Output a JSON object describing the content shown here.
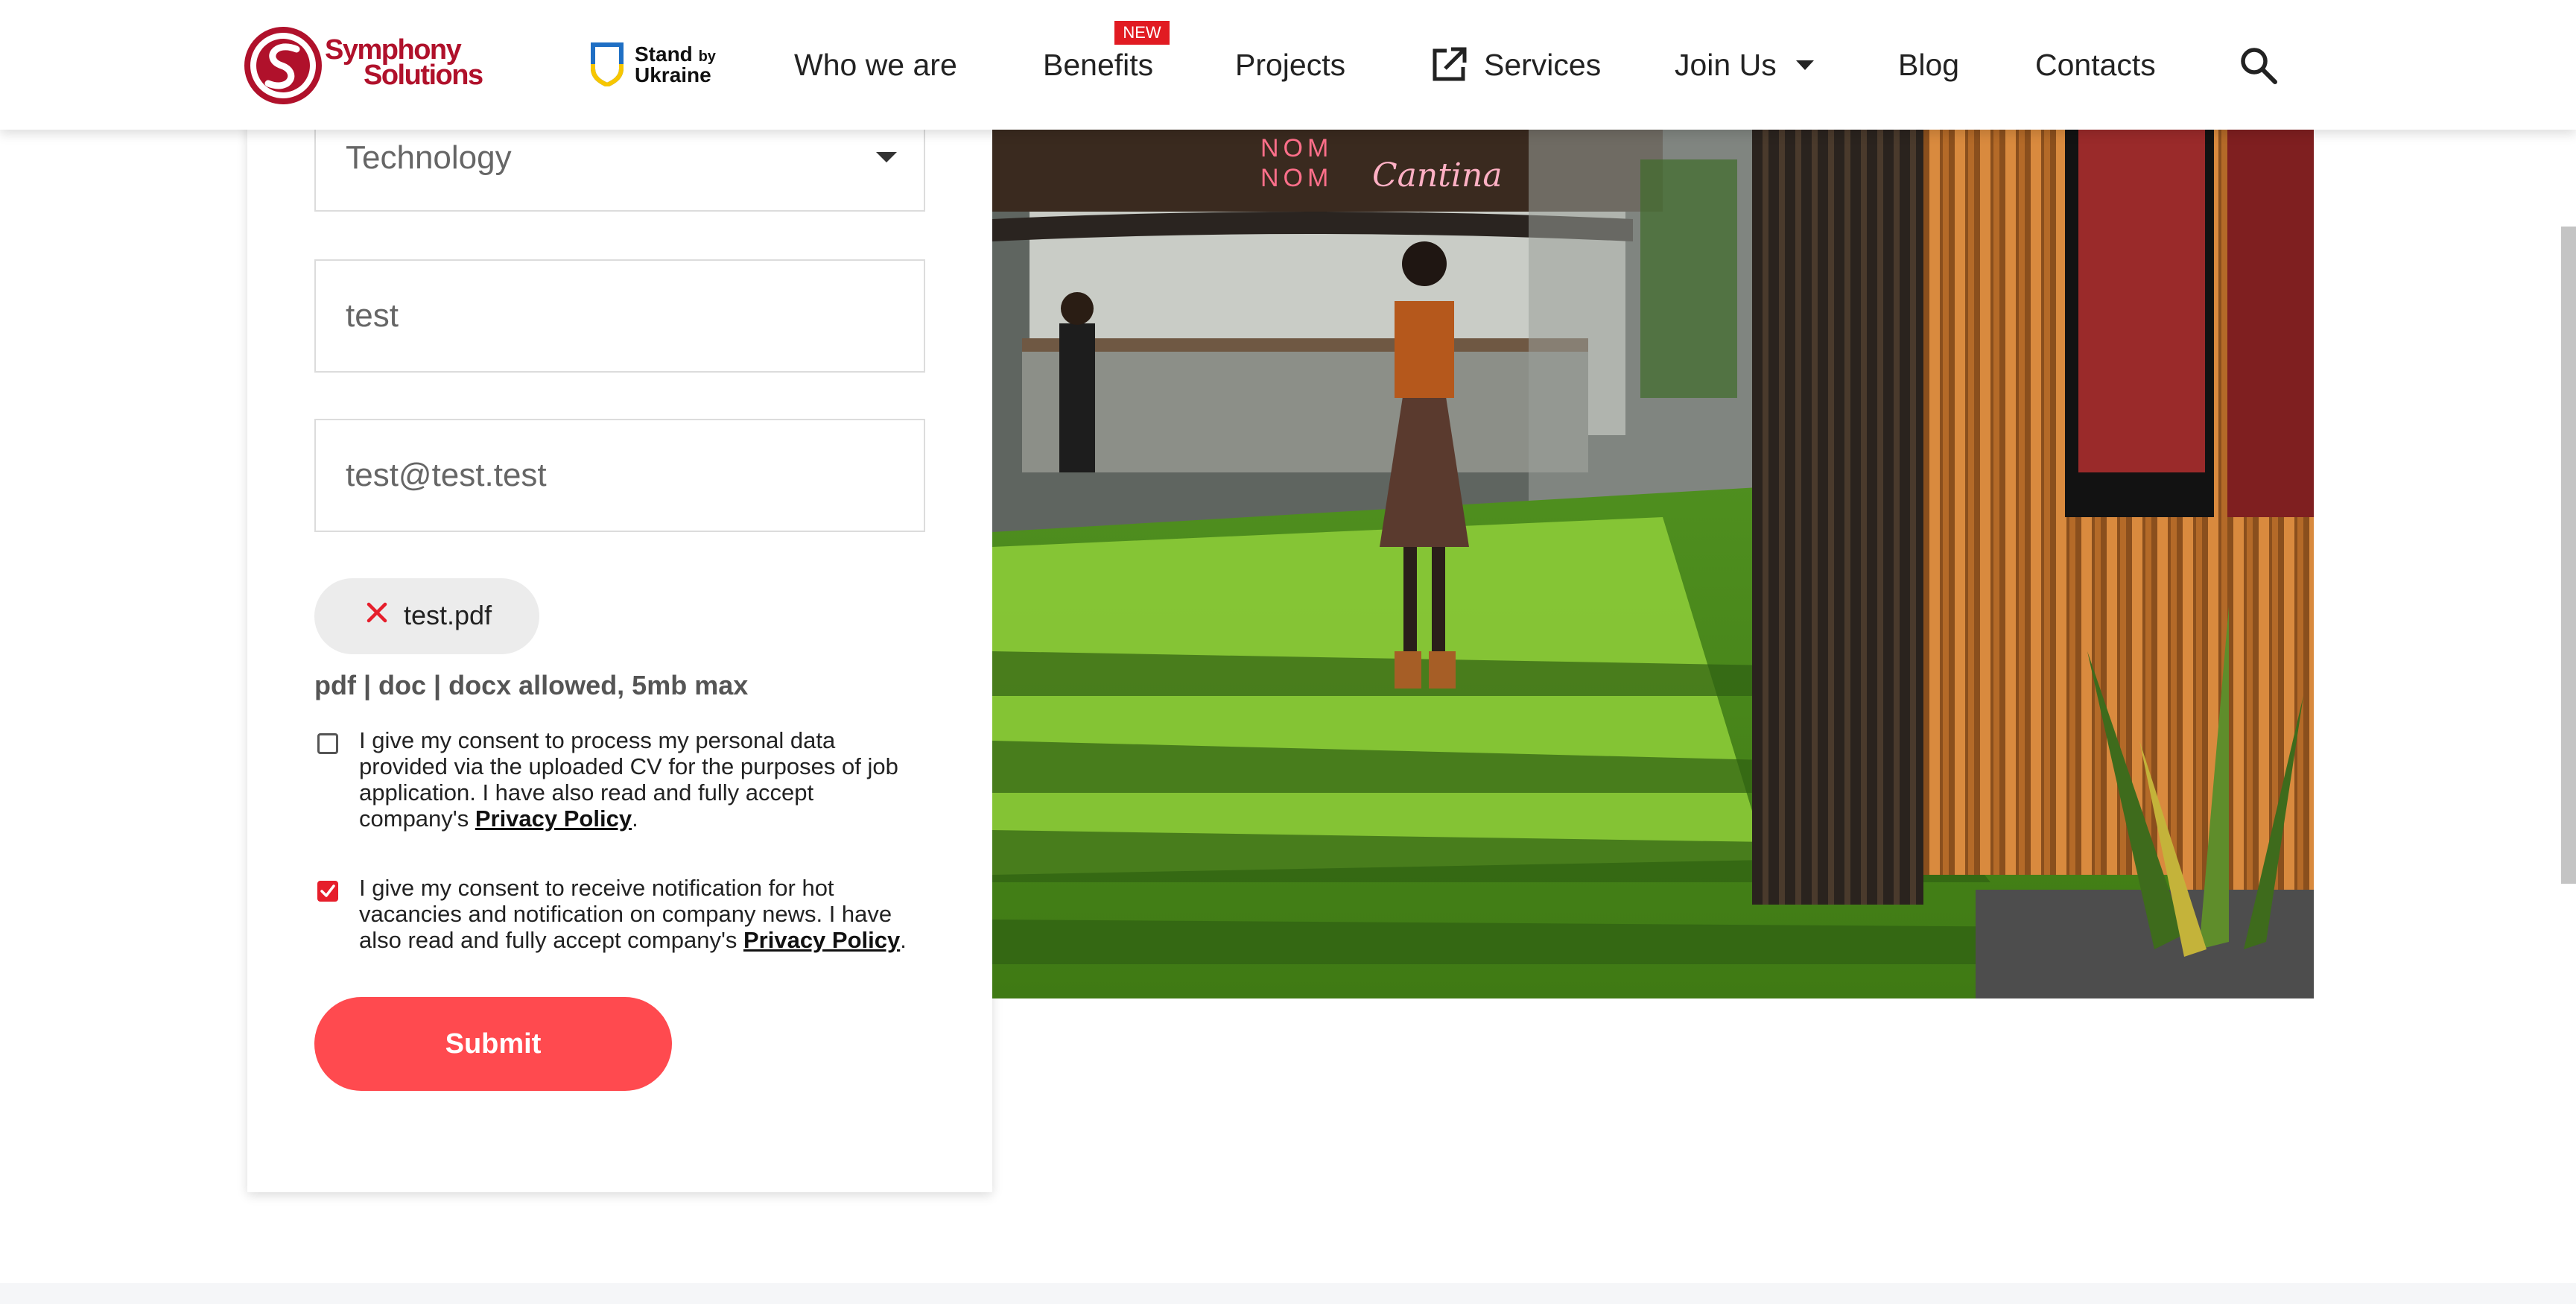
{
  "header": {
    "logo_line1": "Symphony",
    "logo_line2": "Solutions",
    "ukraine_line1": "Stand",
    "ukraine_by": "by",
    "ukraine_line2": "Ukraine",
    "nav": {
      "who": "Who we are",
      "benefits": "Benefits",
      "benefits_badge": "NEW",
      "projects": "Projects",
      "services": "Services",
      "join_us": "Join Us",
      "blog": "Blog",
      "contacts": "Contacts"
    },
    "brand_color": "#b0112b"
  },
  "form": {
    "category_value": "Technology",
    "name_value": "test",
    "email_value": "test@test.test",
    "attached_file": "test.pdf",
    "file_hint": "pdf | doc | docx allowed, 5mb max",
    "consent_cv": {
      "checked": false,
      "text": "I give my consent to process my personal data provided via the uploaded CV for the purposes of job application. I have also read and fully accept company's ",
      "link": "Privacy Policy",
      "end": "."
    },
    "consent_news": {
      "checked": true,
      "text": "I give my consent to receive notification for hot vacancies and notification on company news. I have also read and fully accept company's ",
      "link": "Privacy Policy",
      "end": "."
    },
    "submit_label": "Submit",
    "accent_color": "#ff4a4f"
  },
  "photo": {
    "sign_line1": "NOM",
    "sign_line2": "NOM",
    "sign_script": "Cantina"
  }
}
